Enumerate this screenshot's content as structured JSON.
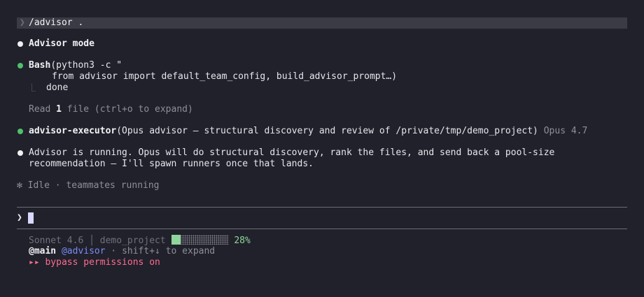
{
  "command": {
    "prompt_glyph": "❯",
    "text": "/advisor ."
  },
  "messages": {
    "advisor_mode": "Advisor mode",
    "bash_tool": "Bash",
    "bash_args": "(python3 -c \"",
    "bash_code": "from advisor import default_team_config, build_advisor_prompt…)",
    "bash_result_glyph": "⎿",
    "bash_result": "done",
    "read_prefix": "Read ",
    "read_count": "1",
    "read_suffix": " file (ctrl+o to expand)",
    "executor_tool": "advisor-executor",
    "executor_args": "(Opus advisor — structural discovery and review of /private/tmp/demo_project)",
    "executor_model": "Opus 4.7",
    "advisor_line1": "Advisor is running. Opus will do structural discovery, rank the files, and send back a pool-size",
    "advisor_line2": "recommendation — I'll spawn runners once that lands.",
    "idle_glyph": "✻",
    "idle_text": "Idle · teammates running"
  },
  "input": {
    "prompt_glyph": "❯",
    "value": ""
  },
  "status": {
    "model": "Sonnet 4.6",
    "separator": "│",
    "project": "demo_project",
    "context_percent": 28,
    "context_label": "28%",
    "branch": "@main",
    "agent": "@advisor",
    "hint": "· shift+↓ to expand",
    "bypass_glyph": "▸▸",
    "bypass_text": "bypass permissions on"
  },
  "colors": {
    "background": "#20212b",
    "accent": "#7b8cf5",
    "success": "#4ec06a",
    "progress": "#8fd49a",
    "warning": "#ff6b8f"
  }
}
